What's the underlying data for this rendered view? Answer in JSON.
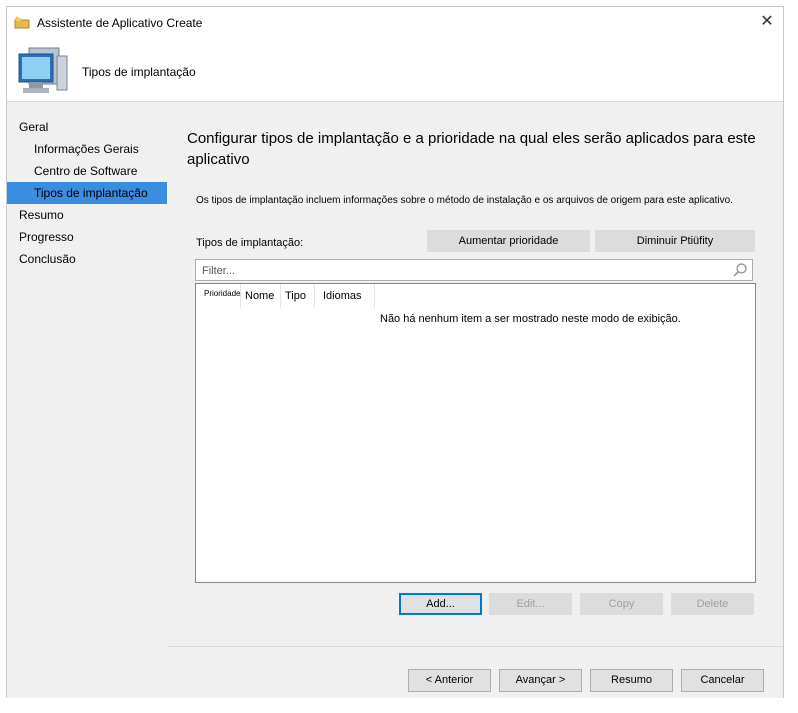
{
  "window": {
    "title": "Assistente de Aplicativo Create",
    "close_icon": "close-icon"
  },
  "header": {
    "title": "Tipos de implantação",
    "icon": "computer-monitor-icon"
  },
  "sidebar": {
    "items": [
      {
        "label": "Geral",
        "level": 0,
        "selected": false
      },
      {
        "label": "Informações Gerais",
        "level": 1,
        "selected": false
      },
      {
        "label": "Centro de Software",
        "level": 1,
        "selected": false
      },
      {
        "label": "Tipos de implantação",
        "level": 1,
        "selected": true
      },
      {
        "label": "Resumo",
        "level": 0,
        "selected": false
      },
      {
        "label": "Progresso",
        "level": 0,
        "selected": false
      },
      {
        "label": "Conclusão",
        "level": 0,
        "selected": false
      }
    ]
  },
  "main": {
    "heading": "Configurar tipos de implantação e a prioridade na qual eles serão aplicados para este aplicativo",
    "description": "Os tipos de implantação incluem informações sobre o método de instalação e os arquivos de origem para este aplicativo.",
    "types_label": "Tipos de implantação:",
    "increase_priority": "Aumentar prioridade",
    "decrease_priority": "Diminuir Ptiüfity",
    "filter": {
      "value": "",
      "placeholder": "Filter..."
    },
    "columns": [
      "Prioridade",
      "Nome",
      "Tipo",
      "Idiomas"
    ],
    "empty_message": "Não há nenhum item a ser mostrado neste modo de exibição.",
    "actions": {
      "add": "Add...",
      "edit": "Edit...",
      "copy": "Copy",
      "delete": "Delete"
    }
  },
  "footer": {
    "previous": "< Anterior",
    "next": "Avançar >",
    "summary": "Resumo",
    "cancel": "Cancelar"
  },
  "colors": {
    "selected_nav": "#3b8ddf",
    "panel_bg": "#f0f0f0",
    "focus_border": "#0078d7"
  }
}
